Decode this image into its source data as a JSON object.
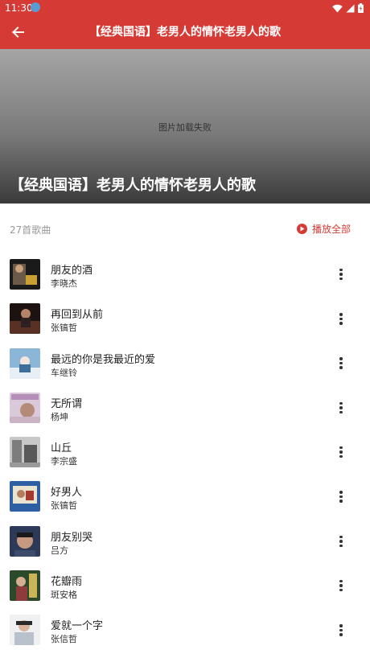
{
  "status_bar": {
    "time": "11:30"
  },
  "app_bar": {
    "title": "【经典国语】老男人的情怀老男人的歌",
    "back_icon": "arrow-left-icon"
  },
  "hero": {
    "fail_text": "图片加载失败",
    "title": "【经典国语】老男人的情怀老男人的歌"
  },
  "list_header": {
    "count_label": "27首歌曲",
    "play_all_label": "播放全部"
  },
  "colors": {
    "brand": "#d63a35",
    "text": "#222222",
    "muted": "#999999"
  },
  "songs": [
    {
      "name": "朋友的酒",
      "artist": "李晓杰"
    },
    {
      "name": "再回到从前",
      "artist": "张镐哲"
    },
    {
      "name": "最远的你是我最近的爱",
      "artist": "车继铃"
    },
    {
      "name": "无所谓",
      "artist": "杨坤"
    },
    {
      "name": "山丘",
      "artist": "李宗盛"
    },
    {
      "name": "好男人",
      "artist": "张镐哲"
    },
    {
      "name": "朋友别哭",
      "artist": "吕方"
    },
    {
      "name": "花瓣雨",
      "artist": "斑安格"
    },
    {
      "name": "爱就一个字",
      "artist": "张信哲"
    }
  ]
}
